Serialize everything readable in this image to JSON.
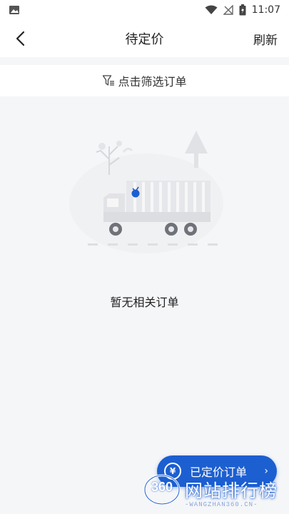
{
  "status_bar": {
    "time": "11:07",
    "icons": [
      "image-icon",
      "wifi-icon",
      "signal-icon",
      "battery-icon"
    ]
  },
  "nav": {
    "title": "待定价",
    "refresh_label": "刷新",
    "back_icon": "chevron-left-icon"
  },
  "filter": {
    "label": "点击筛选订单",
    "icon": "filter-icon"
  },
  "empty": {
    "message": "暂无相关订单",
    "illustration": "empty-truck-illustration"
  },
  "fab": {
    "label": "已定价订单",
    "icon_glyph": "¥",
    "chevron": "›"
  },
  "watermark": {
    "badge": "360",
    "title": "网站排行榜",
    "subtitle": "-WANGZHAN360.CN-"
  },
  "colors": {
    "accent": "#1c5fd1",
    "background": "#f5f6f8",
    "surface": "#ffffff"
  }
}
